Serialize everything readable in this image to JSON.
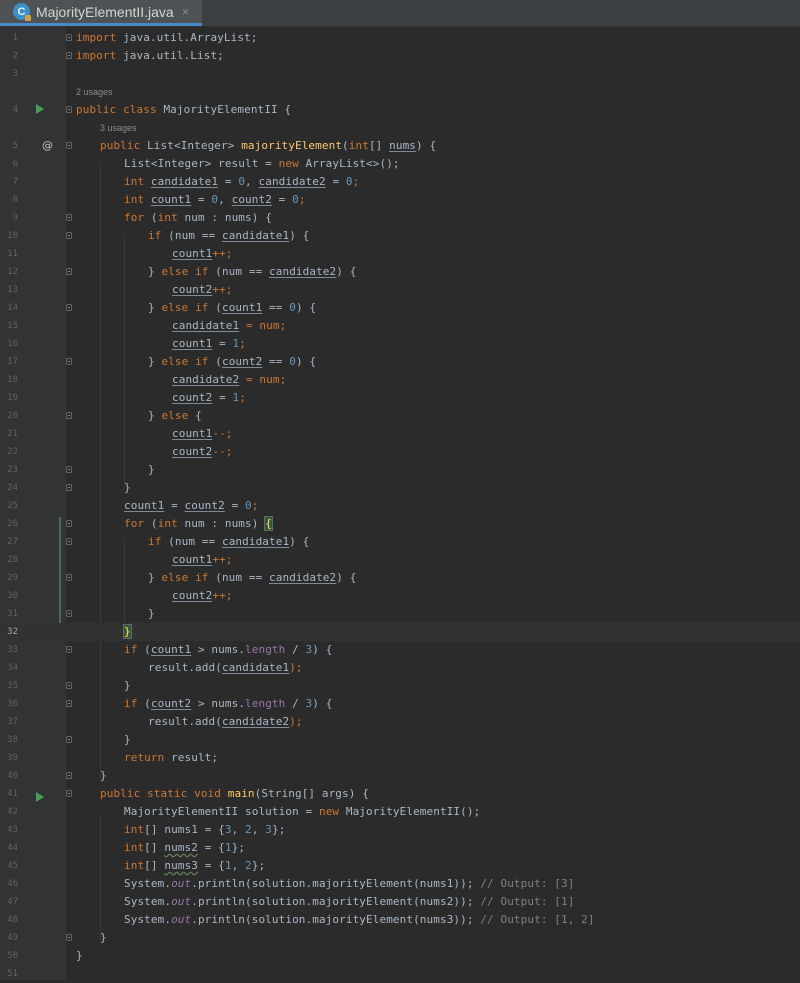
{
  "tab": {
    "filename": "MajorityElementII.java",
    "icon": "java-class-icon",
    "close": "×"
  },
  "usages": {
    "class": "2 usages",
    "method": "3 usages"
  },
  "code": {
    "l1": [
      "import",
      " java.util.ArrayList;"
    ],
    "l2": [
      "import",
      " java.util.List;"
    ],
    "l4": [
      "public",
      "class",
      "MajorityElementII {"
    ],
    "l5": [
      "public",
      "List<Integer> ",
      "majorityElement",
      "(",
      "int",
      "[] ",
      "nums",
      ") {"
    ],
    "l6": [
      "List<Integer> result = ",
      "new",
      " ArrayList<>();"
    ],
    "l7": [
      "int",
      "candidate1",
      " = ",
      "0",
      ", ",
      "candidate2",
      " = ",
      "0",
      ";"
    ],
    "l8": [
      "int",
      "count1",
      " = ",
      "0",
      ", ",
      "count2",
      " = ",
      "0",
      ";"
    ],
    "l9": [
      "for",
      " (",
      "int",
      " num : nums) {"
    ],
    "l10": [
      "if",
      " (num == ",
      "candidate1",
      ") {"
    ],
    "l11": [
      "count1",
      "++;"
    ],
    "l12": [
      "} ",
      "else if",
      " (num == ",
      "candidate2",
      ") {"
    ],
    "l13": [
      "count2",
      "++;"
    ],
    "l14": [
      "} ",
      "else if",
      " (",
      "count1",
      " == ",
      "0",
      ") {"
    ],
    "l15": [
      "candidate1",
      " = num;"
    ],
    "l16": [
      "count1",
      " = ",
      "1",
      ";"
    ],
    "l17": [
      "} ",
      "else if",
      " (",
      "count2",
      " == ",
      "0",
      ") {"
    ],
    "l18": [
      "candidate2",
      " = num;"
    ],
    "l19": [
      "count2",
      " = ",
      "1",
      ";"
    ],
    "l20": [
      "} ",
      "else",
      " {"
    ],
    "l21": [
      "count1",
      "--;"
    ],
    "l22": [
      "count2",
      "--;"
    ],
    "l23": [
      "}"
    ],
    "l24": [
      "}"
    ],
    "l25": [
      "count1",
      " = ",
      "count2",
      " = ",
      "0",
      ";"
    ],
    "l26": [
      "for",
      " (",
      "int",
      " num : nums) ",
      "{"
    ],
    "l27": [
      "if",
      " (num == ",
      "candidate1",
      ") {"
    ],
    "l28": [
      "count1",
      "++;"
    ],
    "l29": [
      "} ",
      "else if",
      " (num == ",
      "candidate2",
      ") {"
    ],
    "l30": [
      "count2",
      "++;"
    ],
    "l31": [
      "}"
    ],
    "l32": [
      "}"
    ],
    "l33": [
      "if",
      " (",
      "count1",
      " > nums.",
      "length",
      " / ",
      "3",
      ") {"
    ],
    "l34": [
      "result.add(",
      "candidate1",
      ");"
    ],
    "l35": [
      "}"
    ],
    "l36": [
      "if",
      " (",
      "count2",
      " > nums.",
      "length",
      " / ",
      "3",
      ") {"
    ],
    "l37": [
      "result.add(",
      "candidate2",
      ");"
    ],
    "l38": [
      "}"
    ],
    "l39": [
      "return",
      " result;"
    ],
    "l40": [
      "}"
    ],
    "l41": [
      "public static void",
      "main",
      "(String[] args) {"
    ],
    "l42": [
      "MajorityElementII solution = ",
      "new",
      " MajorityElementII();"
    ],
    "l43": [
      "int",
      "[] ",
      "nums1",
      " = {",
      "3",
      ", ",
      "2",
      ", ",
      "3",
      "};"
    ],
    "l44": [
      "int",
      "[] ",
      "nums2",
      " = {",
      "1",
      "};"
    ],
    "l45": [
      "int",
      "[] ",
      "nums3",
      " = {",
      "1",
      ", ",
      "2",
      "};"
    ],
    "l46": [
      "System.",
      "out",
      ".println(solution.majorityElement(nums1)); ",
      "// Output: [3]"
    ],
    "l47": [
      "System.",
      "out",
      ".println(solution.majorityElement(nums2)); ",
      "// Output: [1]"
    ],
    "l48": [
      "System.",
      "out",
      ".println(solution.majorityElement(nums3)); ",
      "// Output: [1, 2]"
    ],
    "l49": [
      "}"
    ],
    "l50": [
      "}"
    ]
  },
  "line_numbers": [
    "1",
    "2",
    "3",
    "4",
    "5",
    "6",
    "7",
    "8",
    "9",
    "10",
    "11",
    "12",
    "13",
    "14",
    "15",
    "16",
    "17",
    "18",
    "19",
    "20",
    "21",
    "22",
    "23",
    "24",
    "25",
    "26",
    "27",
    "28",
    "29",
    "30",
    "31",
    "32",
    "33",
    "34",
    "35",
    "36",
    "37",
    "38",
    "39",
    "40",
    "41",
    "42",
    "43",
    "44",
    "45",
    "46",
    "47",
    "48",
    "49",
    "50",
    "51"
  ],
  "current_line": "32",
  "colors": {
    "keyword": "#cc7832",
    "function": "#ffc66d",
    "number": "#6897bb",
    "comment": "#808080",
    "field": "#9876aa",
    "background": "#2b2b2b"
  }
}
